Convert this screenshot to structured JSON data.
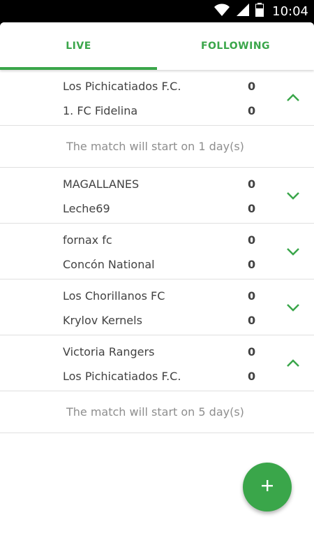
{
  "status_bar": {
    "time": "10:04",
    "icons": [
      "wifi-icon",
      "signal-icon",
      "battery-icon"
    ]
  },
  "tabs": [
    {
      "label": "LIVE",
      "active": true
    },
    {
      "label": "FOLLOWING",
      "active": false
    }
  ],
  "matches": [
    {
      "home": "Los Pichicatiados F.C.",
      "home_score": "0",
      "away": "1. FC Fidelina",
      "away_score": "0",
      "expanded": true,
      "info": "The match will start on 1 day(s)"
    },
    {
      "home": "MAGALLANES",
      "home_score": "0",
      "away": "Leche69",
      "away_score": "0",
      "expanded": false
    },
    {
      "home": "fornax fc",
      "home_score": "0",
      "away": "Concón National",
      "away_score": "0",
      "expanded": false
    },
    {
      "home": "Los Chorillanos FC",
      "home_score": "0",
      "away": "Krylov Kernels",
      "away_score": "0",
      "expanded": false
    },
    {
      "home": "Victoria Rangers",
      "home_score": "0",
      "away": "Los Pichicatiados F.C.",
      "away_score": "0",
      "expanded": true,
      "info": "The match will start on 5 day(s)"
    }
  ],
  "fab": {
    "icon": "plus-icon"
  },
  "colors": {
    "accent": "#3aa64a",
    "text": "#424242",
    "muted": "#8e8e8e",
    "divider": "#e0e0e0"
  }
}
